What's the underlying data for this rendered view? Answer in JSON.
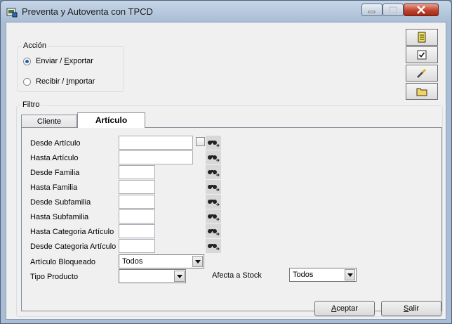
{
  "window": {
    "title": "Preventa y Autoventa con TPCD"
  },
  "accion": {
    "label": "Acción",
    "enviar": {
      "pre": "Enviar / ",
      "key": "E",
      "post": "xportar",
      "selected": true
    },
    "recibir": {
      "pre": "Recibir / ",
      "key": "I",
      "post": "mportar",
      "selected": false
    }
  },
  "filtro": {
    "label": "Filtro"
  },
  "tabs": [
    {
      "label": "Cliente"
    },
    {
      "label": "Artículo"
    }
  ],
  "fields": {
    "desde_articulo": "Desde Artículo",
    "hasta_articulo": "Hasta Artículo",
    "desde_familia": "Desde Familia",
    "hasta_familia": "Hasta Familia",
    "desde_subfamilia": "Desde Subfamilia",
    "hasta_subfamilia": "Hasta Subfamilia",
    "hasta_categoria": "Hasta Categoria Artículo",
    "desde_categoria": "Desde Categoria Artículo",
    "articulo_bloqueado": "Artículo Bloqueado",
    "tipo_producto": "Tipo Producto",
    "afecta_stock": "Afecta a Stock"
  },
  "values": {
    "articulo_bloqueado": "Todos",
    "tipo_producto": "",
    "afecta_stock": "Todos"
  },
  "buttons": {
    "aceptar": {
      "key": "A",
      "rest": "ceptar"
    },
    "salir": {
      "key": "S",
      "rest": "alir"
    }
  },
  "colors": {
    "accent": "#1f5fb0",
    "close": "#c0432e"
  }
}
